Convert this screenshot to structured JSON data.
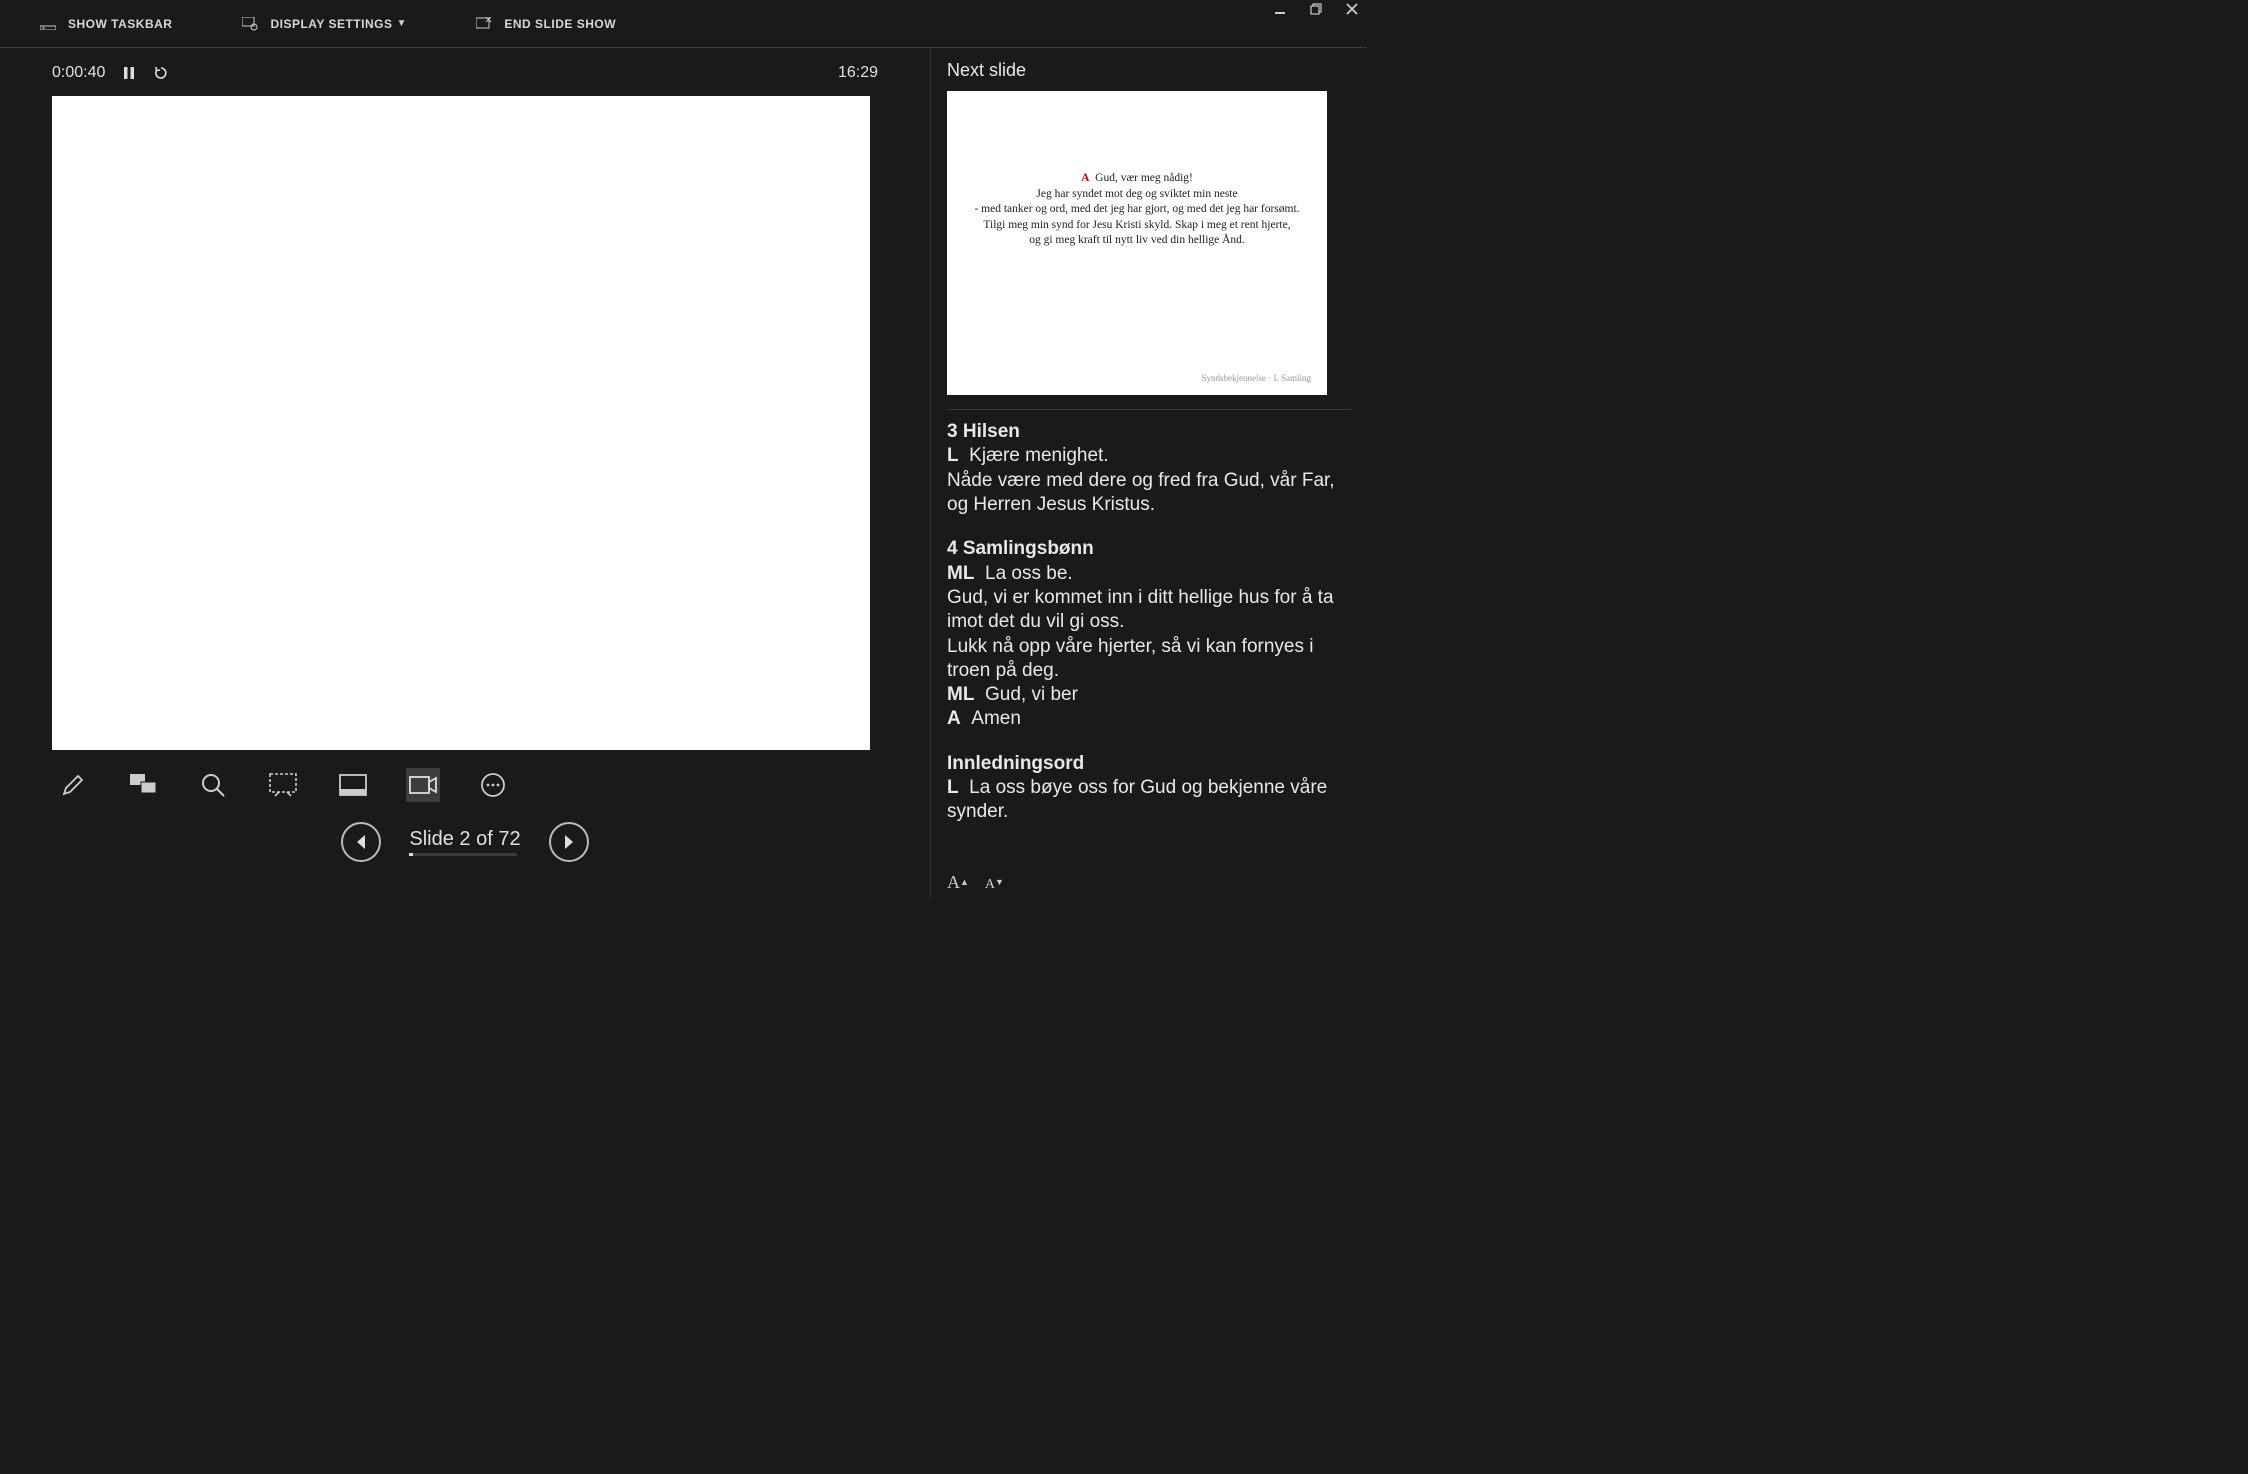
{
  "toolbar": {
    "show_taskbar": "SHOW TASKBAR",
    "display_settings": "DISPLAY SETTINGS",
    "end_slide_show": "END SLIDE SHOW"
  },
  "timer": {
    "elapsed": "0:00:40",
    "clock": "16:29"
  },
  "nav": {
    "slide_counter": "Slide 2 of 72"
  },
  "right": {
    "heading": "Next slide",
    "preview": {
      "prefix": "A",
      "line1": "Gud, vær meg nådig!",
      "line2": "Jeg har syndet mot deg og sviktet min neste",
      "line3": "- med tanker og ord, med det jeg har gjort, og med det jeg har forsømt.",
      "line4": "Tilgi meg min synd for Jesu Kristi skyld. Skap i meg et rent hjerte,",
      "line5": "og gi meg kraft til nytt liv ved din hellige Ånd.",
      "footer": "Syndsbekjennelse · I. Samling"
    },
    "notes": {
      "s3_title": "3 Hilsen",
      "s3_l_prefix": "L",
      "s3_l_text": "Kjære menighet.",
      "s3_body": "Nåde være med dere og fred fra Gud, vår Far, og Herren Jesus Kristus.",
      "s4_title": "4 Samlingsbønn",
      "s4_ml1_prefix": "ML",
      "s4_ml1_text": "La oss be.",
      "s4_body1": "Gud, vi er kommet inn i ditt hellige hus for å ta imot det du vil gi oss.",
      "s4_body2": "Lukk nå opp våre hjerter, så vi kan fornyes i troen på deg.",
      "s4_ml2_prefix": "ML",
      "s4_ml2_text": "Gud, vi ber",
      "s4_a_prefix": "A",
      "s4_a_text": "Amen",
      "s5_title": "Innledningsord",
      "s5_l_prefix": "L",
      "s5_l_text": "La oss bøye oss for Gud og bekjenne våre synder."
    }
  }
}
